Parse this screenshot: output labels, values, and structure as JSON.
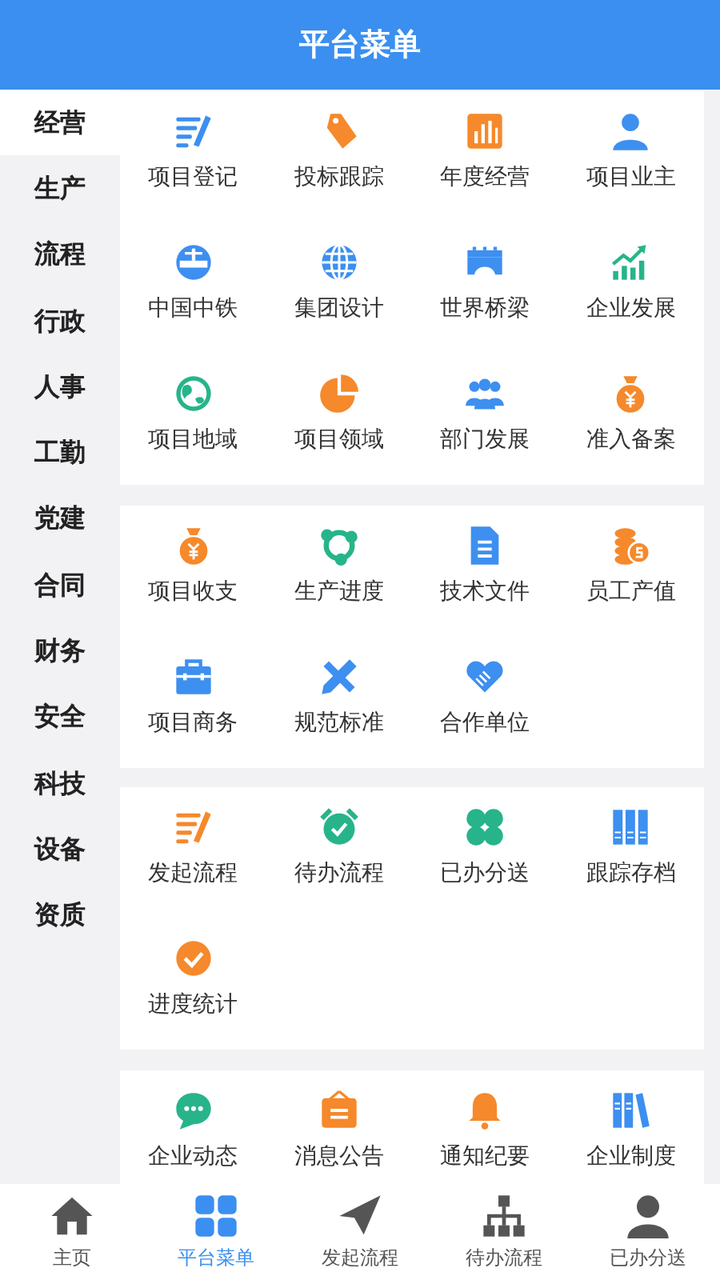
{
  "header": {
    "title": "平台菜单"
  },
  "sidebar": {
    "items": [
      {
        "label": "经营",
        "selected": true
      },
      {
        "label": "生产",
        "selected": false
      },
      {
        "label": "流程",
        "selected": false
      },
      {
        "label": "行政",
        "selected": false
      },
      {
        "label": "人事",
        "selected": false
      },
      {
        "label": "工勤",
        "selected": false
      },
      {
        "label": "党建",
        "selected": false
      },
      {
        "label": "合同",
        "selected": false
      },
      {
        "label": "财务",
        "selected": false
      },
      {
        "label": "安全",
        "selected": false
      },
      {
        "label": "科技",
        "selected": false
      },
      {
        "label": "设备",
        "selected": false
      },
      {
        "label": "资质",
        "selected": false
      }
    ]
  },
  "sections": [
    {
      "items": [
        {
          "label": "项目登记"
        },
        {
          "label": "投标跟踪"
        },
        {
          "label": "年度经营"
        },
        {
          "label": "项目业主"
        },
        {
          "label": "中国中铁"
        },
        {
          "label": "集团设计"
        },
        {
          "label": "世界桥梁"
        },
        {
          "label": "企业发展"
        },
        {
          "label": "项目地域"
        },
        {
          "label": "项目领域"
        },
        {
          "label": "部门发展"
        },
        {
          "label": "准入备案"
        }
      ]
    },
    {
      "items": [
        {
          "label": "项目收支"
        },
        {
          "label": "生产进度"
        },
        {
          "label": "技术文件"
        },
        {
          "label": "员工产值"
        },
        {
          "label": "项目商务"
        },
        {
          "label": "规范标准"
        },
        {
          "label": "合作单位"
        }
      ]
    },
    {
      "items": [
        {
          "label": "发起流程"
        },
        {
          "label": "待办流程"
        },
        {
          "label": "已办分送"
        },
        {
          "label": "跟踪存档"
        },
        {
          "label": "进度统计"
        }
      ]
    },
    {
      "items": [
        {
          "label": "企业动态"
        },
        {
          "label": "消息公告"
        },
        {
          "label": "通知纪要"
        },
        {
          "label": "企业制度"
        }
      ]
    }
  ],
  "tab_bar": [
    {
      "label": "主页",
      "selected": false
    },
    {
      "label": "平台菜单",
      "selected": true
    },
    {
      "label": "发起流程",
      "selected": false
    },
    {
      "label": "待办流程",
      "selected": false
    },
    {
      "label": "已办分送",
      "selected": false
    }
  ]
}
